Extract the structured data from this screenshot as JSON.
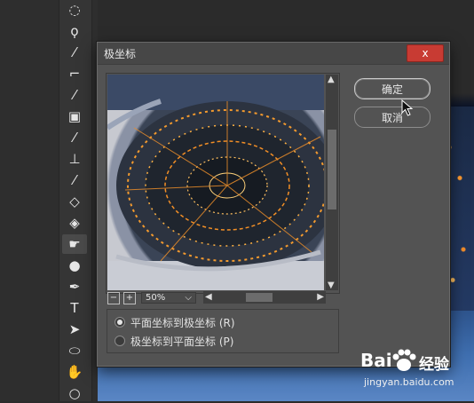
{
  "dialog": {
    "title": "极坐标",
    "close_label": "x",
    "ok_label": "确定",
    "cancel_label": "取消",
    "zoom": {
      "value": "50%",
      "minus": "−",
      "plus": "+"
    },
    "options": [
      {
        "label": "平面坐标到极坐标 (R)",
        "checked": true
      },
      {
        "label": "极坐标到平面坐标 (P)",
        "checked": false
      }
    ]
  },
  "toolbar": {
    "tools": [
      {
        "icon": "marquee-icon",
        "glyph": "◌"
      },
      {
        "icon": "lasso-icon",
        "glyph": "ϙ"
      },
      {
        "icon": "magic-wand-icon",
        "glyph": "⁄"
      },
      {
        "icon": "crop-icon",
        "glyph": "⌐"
      },
      {
        "icon": "eyedropper-icon",
        "glyph": "⁄"
      },
      {
        "icon": "frame-icon",
        "glyph": "▣"
      },
      {
        "icon": "brush-icon",
        "glyph": "⁄"
      },
      {
        "icon": "stamp-icon",
        "glyph": "⊥"
      },
      {
        "icon": "history-brush-icon",
        "glyph": "⁄"
      },
      {
        "icon": "eraser-icon",
        "glyph": "◇"
      },
      {
        "icon": "paint-bucket-icon",
        "glyph": "◈"
      },
      {
        "icon": "smudge-icon",
        "glyph": "☛"
      },
      {
        "icon": "dodge-icon",
        "glyph": "●"
      },
      {
        "icon": "pen-icon",
        "glyph": "✒"
      },
      {
        "icon": "type-icon",
        "glyph": "T"
      },
      {
        "icon": "path-select-icon",
        "glyph": "➤"
      },
      {
        "icon": "ellipse-icon",
        "glyph": "⬭"
      },
      {
        "icon": "hand-icon",
        "glyph": "✋"
      },
      {
        "icon": "zoom-icon",
        "glyph": "○"
      }
    ],
    "active_index": 11
  },
  "watermark": {
    "brand": "Bai",
    "name_cn": "经验",
    "url": "jingyan.baidu.com"
  },
  "colors": {
    "dialog_bg": "#535353",
    "close_red": "#c83b33",
    "city_light": "#f6a53c"
  }
}
